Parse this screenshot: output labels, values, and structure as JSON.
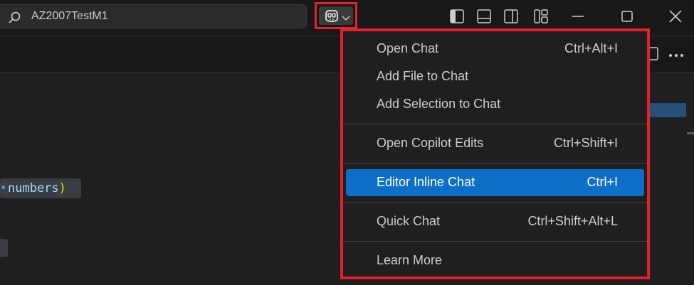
{
  "search": {
    "text": "AZ2007TestM1"
  },
  "titlebar": {
    "icons": [
      "search-icon",
      "copilot-icon",
      "chevron-down-icon",
      "toggle-primary-sidebar-icon",
      "toggle-panel-icon",
      "toggle-secondary-sidebar-icon",
      "customize-layout-icon",
      "minimize-icon",
      "maximize-icon",
      "close-icon"
    ]
  },
  "editor": {
    "token_name": "numbers",
    "token_paren": ")"
  },
  "menu": {
    "items": [
      {
        "label": "Open Chat",
        "keys": "Ctrl+Alt+I"
      },
      {
        "label": "Add File to Chat",
        "keys": ""
      },
      {
        "label": "Add Selection to Chat",
        "keys": ""
      },
      {
        "label": "Open Copilot Edits",
        "keys": "Ctrl+Shift+I"
      },
      {
        "label": "Editor Inline Chat",
        "keys": "Ctrl+I",
        "active": true
      },
      {
        "label": "Quick Chat",
        "keys": "Ctrl+Shift+Alt+L"
      },
      {
        "label": "Learn More",
        "keys": ""
      }
    ]
  },
  "colors": {
    "highlight": "#e5202a",
    "accent": "#0e6fc8"
  }
}
